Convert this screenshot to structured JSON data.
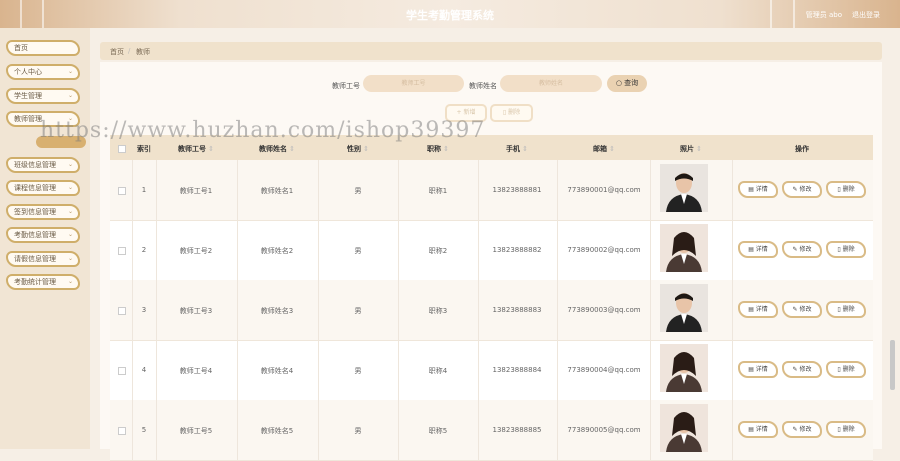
{
  "header": {
    "title": "学生考勤管理系统",
    "user": "管理员 abo",
    "logout": "退出登录"
  },
  "sidebar": {
    "items": [
      {
        "label": "首页",
        "chevron": false
      },
      {
        "label": "个人中心",
        "chevron": true
      },
      {
        "label": "学生管理",
        "chevron": true
      },
      {
        "label": "教师管理",
        "chevron": true
      },
      {
        "label": "班级信息管理",
        "chevron": true
      },
      {
        "label": "课程信息管理",
        "chevron": true
      },
      {
        "label": "签到信息管理",
        "chevron": true
      },
      {
        "label": "考勤信息管理",
        "chevron": true
      },
      {
        "label": "请假信息管理",
        "chevron": true
      },
      {
        "label": "考勤统计管理",
        "chevron": true
      }
    ]
  },
  "breadcrumb": {
    "home": "首页",
    "sep": "/",
    "current": "教师"
  },
  "search": {
    "teacher_no_label": "教师工号",
    "teacher_no_placeholder": "教师工号",
    "teacher_name_label": "教师姓名",
    "teacher_name_placeholder": "教师姓名",
    "search_button": "查询"
  },
  "actions": {
    "add": "+ 新增",
    "delete": "删除"
  },
  "table": {
    "headers": [
      "索引",
      "教师工号",
      "教师姓名",
      "性别",
      "职称",
      "手机",
      "邮箱",
      "照片",
      "操作"
    ],
    "rows": [
      {
        "index": "1",
        "no": "教师工号1",
        "name": "教师姓名1",
        "gender": "男",
        "title": "职称1",
        "phone": "13823888881",
        "email": "773890001@qq.com"
      },
      {
        "index": "2",
        "no": "教师工号2",
        "name": "教师姓名2",
        "gender": "男",
        "title": "职称2",
        "phone": "13823888882",
        "email": "773890002@qq.com"
      },
      {
        "index": "3",
        "no": "教师工号3",
        "name": "教师姓名3",
        "gender": "男",
        "title": "职称3",
        "phone": "13823888883",
        "email": "773890003@qq.com"
      },
      {
        "index": "4",
        "no": "教师工号4",
        "name": "教师姓名4",
        "gender": "男",
        "title": "职称4",
        "phone": "13823888884",
        "email": "773890004@qq.com"
      },
      {
        "index": "5",
        "no": "教师工号5",
        "name": "教师姓名5",
        "gender": "男",
        "title": "职称5",
        "phone": "13823888885",
        "email": "773890005@qq.com"
      }
    ],
    "row_actions": {
      "detail": "详情",
      "edit": "修改",
      "delete": "删除"
    }
  },
  "watermark": "https://www.huzhan.com/ishop39397",
  "colors": {
    "accent": "#d8b070",
    "border": "#cfae6a",
    "header_bg": "#f0e2cc"
  }
}
